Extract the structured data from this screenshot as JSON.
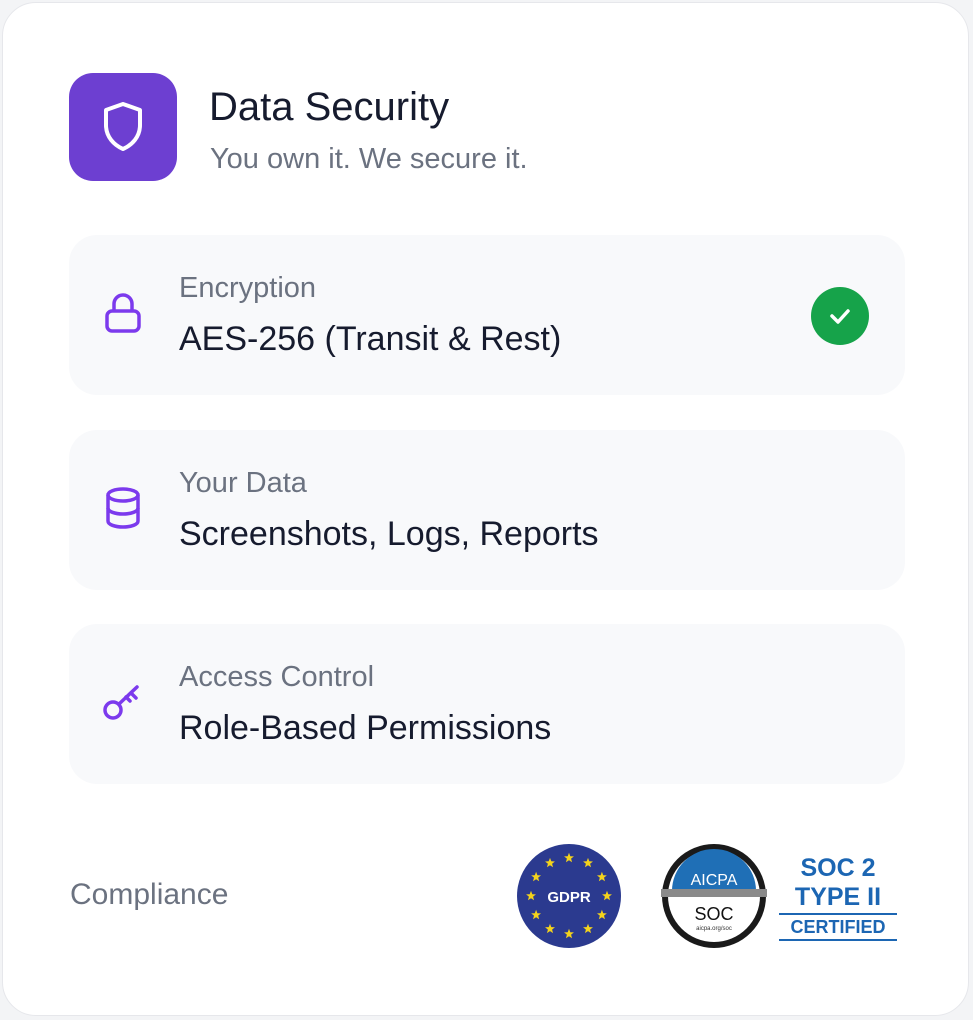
{
  "header": {
    "title": "Data Security",
    "subtitle": "You own it. We secure it.",
    "icon": "shield-icon",
    "accent": "#6d3fd1"
  },
  "items": [
    {
      "label": "Encryption",
      "value": "AES-256 (Transit & Rest)",
      "icon": "lock-icon",
      "status": "check-icon"
    },
    {
      "label": "Your Data",
      "value": "Screenshots, Logs, Reports",
      "icon": "database-icon"
    },
    {
      "label": "Access Control",
      "value": "Role-Based Permissions",
      "icon": "key-icon"
    }
  ],
  "compliance": {
    "label": "Compliance",
    "badges": [
      {
        "name": "GDPR",
        "text": "GDPR"
      },
      {
        "name": "AICPA SOC",
        "top": "AICPA",
        "bottom": "SOC",
        "url": "aicpa.org/soc"
      },
      {
        "name": "SOC 2 Type II",
        "line1": "SOC 2",
        "line2": "TYPE II",
        "line3": "CERTIFIED"
      }
    ]
  },
  "colors": {
    "icon_purple": "#7c3aed",
    "check_green": "#16a34a",
    "text_dark": "#161b2e",
    "text_muted": "#6b7280"
  }
}
